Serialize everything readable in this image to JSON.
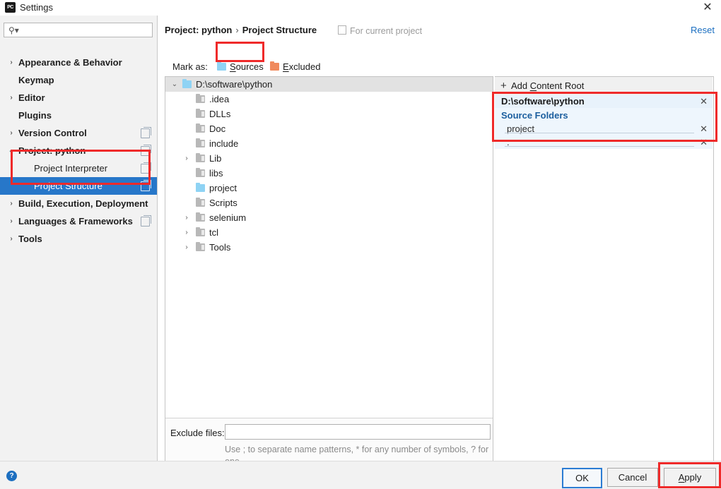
{
  "window": {
    "title": "Settings",
    "app_icon": "pycharm-icon",
    "close_label": "✕"
  },
  "sidebar": {
    "search": {
      "placeholder": "",
      "value": "",
      "icon": "search-icon"
    },
    "items": [
      {
        "label": "Appearance & Behavior",
        "arrow": "›",
        "level": 0,
        "bold": true,
        "copy": false,
        "selected": false
      },
      {
        "label": "Keymap",
        "arrow": "",
        "level": 0,
        "bold": true,
        "copy": false,
        "selected": false
      },
      {
        "label": "Editor",
        "arrow": "›",
        "level": 0,
        "bold": true,
        "copy": false,
        "selected": false
      },
      {
        "label": "Plugins",
        "arrow": "",
        "level": 0,
        "bold": true,
        "copy": false,
        "selected": false
      },
      {
        "label": "Version Control",
        "arrow": "›",
        "level": 0,
        "bold": true,
        "copy": true,
        "selected": false
      },
      {
        "label": "Project: python",
        "arrow": "⌄",
        "level": 0,
        "bold": true,
        "copy": true,
        "selected": false
      },
      {
        "label": "Project Interpreter",
        "arrow": "",
        "level": 1,
        "bold": false,
        "copy": true,
        "selected": false
      },
      {
        "label": "Project Structure",
        "arrow": "",
        "level": 1,
        "bold": false,
        "copy": true,
        "selected": true
      },
      {
        "label": "Build, Execution, Deployment",
        "arrow": "›",
        "level": 0,
        "bold": true,
        "copy": false,
        "selected": false
      },
      {
        "label": "Languages & Frameworks",
        "arrow": "›",
        "level": 0,
        "bold": true,
        "copy": true,
        "selected": false
      },
      {
        "label": "Tools",
        "arrow": "›",
        "level": 0,
        "bold": true,
        "copy": false,
        "selected": false
      }
    ]
  },
  "header": {
    "breadcrumb_project": "Project: python",
    "breadcrumb_sep": "›",
    "breadcrumb_page": "Project Structure",
    "scope_label": "For current project",
    "scope_icon": "project-scope-icon",
    "reset_label": "Reset"
  },
  "markas": {
    "label": "Mark as:",
    "sources_label": "Sources",
    "sources_label_head": "S",
    "sources_label_tail": "ources",
    "excluded_label": "Excluded",
    "excluded_label_head": "E",
    "excluded_label_tail": "xcluded",
    "sources_color": "#8fd3f4",
    "excluded_color": "#f08a5d"
  },
  "filetree": {
    "rows": [
      {
        "name": "D:\\software\\python",
        "depth": 0,
        "arrow": "⌄",
        "icon": "folder-blue",
        "root": true
      },
      {
        "name": ".idea",
        "depth": 1,
        "arrow": "",
        "icon": "folder-grey",
        "root": false
      },
      {
        "name": "DLLs",
        "depth": 1,
        "arrow": "",
        "icon": "folder-grey",
        "root": false
      },
      {
        "name": "Doc",
        "depth": 1,
        "arrow": "",
        "icon": "folder-grey",
        "root": false
      },
      {
        "name": "include",
        "depth": 1,
        "arrow": "",
        "icon": "folder-grey",
        "root": false
      },
      {
        "name": "Lib",
        "depth": 1,
        "arrow": "›",
        "icon": "folder-grey",
        "root": false
      },
      {
        "name": "libs",
        "depth": 1,
        "arrow": "",
        "icon": "folder-grey",
        "root": false
      },
      {
        "name": "project",
        "depth": 1,
        "arrow": "",
        "icon": "folder-blue",
        "root": false
      },
      {
        "name": "Scripts",
        "depth": 1,
        "arrow": "",
        "icon": "folder-grey",
        "root": false
      },
      {
        "name": "selenium",
        "depth": 1,
        "arrow": "›",
        "icon": "folder-grey",
        "root": false
      },
      {
        "name": "tcl",
        "depth": 1,
        "arrow": "›",
        "icon": "folder-grey",
        "root": false
      },
      {
        "name": "Tools",
        "depth": 1,
        "arrow": "›",
        "icon": "folder-grey",
        "root": false
      }
    ]
  },
  "exclude": {
    "label": "Exclude files:",
    "value": "",
    "placeholder": "",
    "hint_line1": "Use ; to separate name patterns, * for any number of symbols,",
    "hint_line2": "? for one."
  },
  "contentroots": {
    "add_label": "Add Content Root",
    "add_label_head": "Add ",
    "add_label_c": "C",
    "add_label_tail": "ontent Root",
    "add_icon": "plus-icon",
    "root_path": "D:\\software\\python",
    "root_remove": "✕",
    "source_folders_title": "Source Folders",
    "entries": [
      {
        "name": "project",
        "remove": "✕"
      },
      {
        "name": ".",
        "remove": "✕"
      }
    ]
  },
  "footer": {
    "help_icon": "help-icon",
    "help_glyph": "?",
    "ok_label": "OK",
    "cancel_label": "Cancel",
    "apply_label": "Apply",
    "apply_label_head": "A",
    "apply_label_tail": "pply"
  },
  "annotations": {
    "color": "#ef2a2a",
    "boxes": [
      {
        "name": "sources-button-highlight"
      },
      {
        "name": "project-structure-highlight"
      },
      {
        "name": "source-folders-highlight"
      },
      {
        "name": "apply-button-highlight"
      }
    ]
  }
}
